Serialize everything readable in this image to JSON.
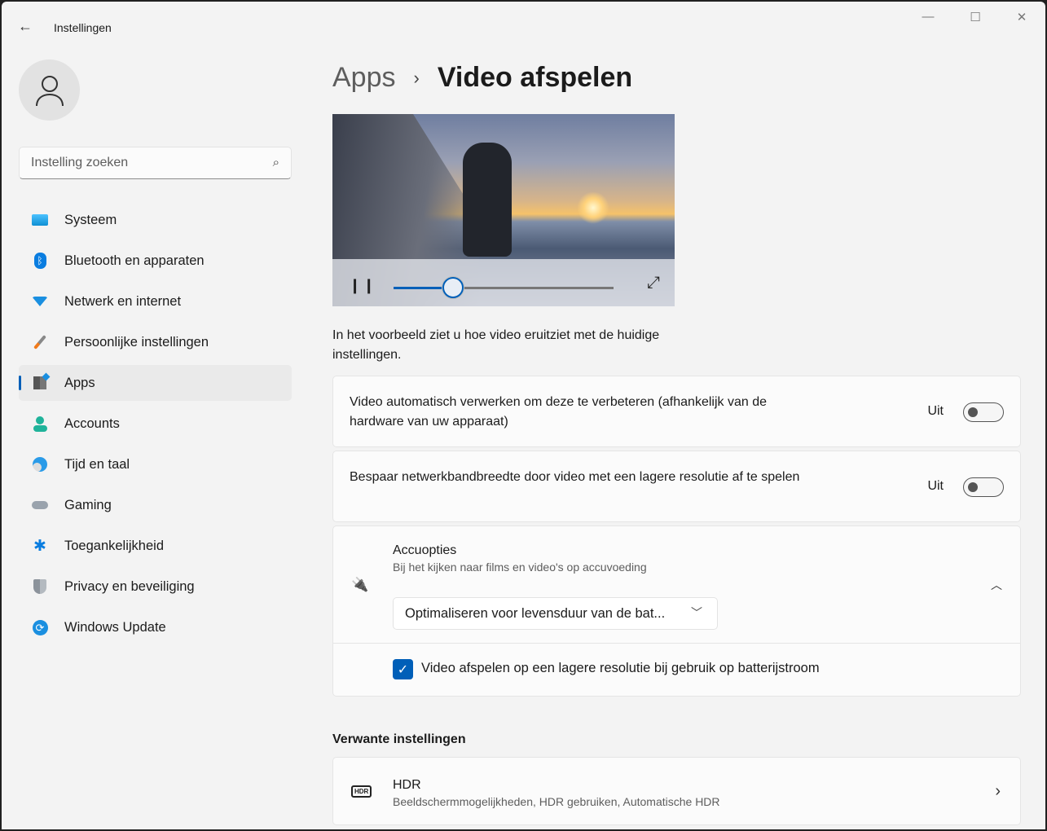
{
  "window": {
    "title": "Instellingen",
    "minimize": "—",
    "maximize": "☐",
    "close": "✕"
  },
  "search": {
    "placeholder": "Instelling zoeken"
  },
  "sidebar": {
    "items": [
      {
        "label": "Systeem",
        "icon": "system-icon"
      },
      {
        "label": "Bluetooth en apparaten",
        "icon": "bluetooth-icon"
      },
      {
        "label": "Netwerk en internet",
        "icon": "wifi-icon"
      },
      {
        "label": "Persoonlijke instellingen",
        "icon": "brush-icon"
      },
      {
        "label": "Apps",
        "icon": "apps-icon",
        "selected": true
      },
      {
        "label": "Accounts",
        "icon": "person-icon"
      },
      {
        "label": "Tijd en taal",
        "icon": "globe-clock-icon"
      },
      {
        "label": "Gaming",
        "icon": "gamepad-icon"
      },
      {
        "label": "Toegankelijkheid",
        "icon": "accessibility-icon"
      },
      {
        "label": "Privacy en beveiliging",
        "icon": "shield-icon"
      },
      {
        "label": "Windows Update",
        "icon": "update-icon"
      }
    ]
  },
  "breadcrumb": {
    "parent": "Apps",
    "separator": "›",
    "current": "Video afspelen"
  },
  "preview": {
    "progress_percent": 27,
    "description": "In het voorbeeld ziet u hoe video eruitziet met de huidige instellingen."
  },
  "settings": [
    {
      "label": "Video automatisch verwerken om deze te verbeteren (afhankelijk van de hardware van uw apparaat)",
      "state": "Uit",
      "on": false
    },
    {
      "label": "Bespaar netwerkbandbreedte door video met een lagere resolutie af te spelen",
      "state": "Uit",
      "on": false
    }
  ],
  "battery": {
    "title": "Accuopties",
    "subtitle": "Bij het kijken naar films en video's op accuvoeding",
    "dropdown_value": "Optimaliseren voor levensduur van de bat...",
    "checkbox_label": "Video afspelen op een lagere resolutie bij gebruik op batterijstroom",
    "checked": true
  },
  "related": {
    "heading": "Verwante instellingen",
    "items": [
      {
        "title": "HDR",
        "subtitle": "Beeldschermmogelijkheden, HDR gebruiken, Automatische HDR",
        "icon_text": "HDR"
      }
    ]
  },
  "colors": {
    "accent": "#005fb8"
  }
}
